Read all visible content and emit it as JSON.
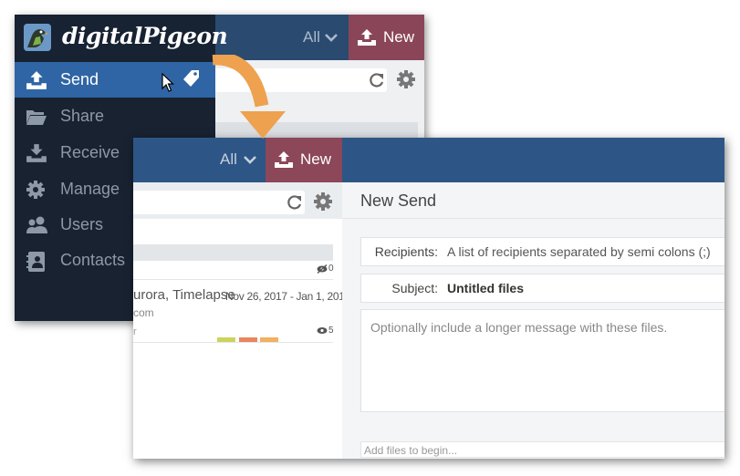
{
  "app": {
    "brand": "digitalPigeon"
  },
  "back_window": {
    "filter": {
      "label": "All",
      "icon": "chevron-down-icon"
    },
    "new_button": {
      "label": "New",
      "icon": "upload-tray-icon"
    },
    "sidebar": {
      "items": [
        {
          "label": "Send",
          "icon": "upload-tray-icon",
          "active": true
        },
        {
          "label": "Share",
          "icon": "folder-open-icon",
          "active": false
        },
        {
          "label": "Receive",
          "icon": "download-tray-icon",
          "active": false
        },
        {
          "label": "Manage",
          "icon": "gear-icon",
          "active": false
        },
        {
          "label": "Users",
          "icon": "users-icon",
          "active": false
        },
        {
          "label": "Contacts",
          "icon": "address-book-icon",
          "active": false
        }
      ]
    }
  },
  "front_window": {
    "filter": {
      "label": "All",
      "icon": "chevron-down-icon"
    },
    "new_button": {
      "label": "New",
      "icon": "upload-tray-icon"
    },
    "list": {
      "hidden_count": "0",
      "items": [
        {
          "name": "urora, Timelapse",
          "dates": "Nov 26, 2017 - Jan 1, 2019",
          "sub": "com",
          "sub2": "r",
          "views": "5",
          "colors": [
            "#cdd35a",
            "#e8875c",
            "#f2b060"
          ]
        }
      ]
    },
    "form": {
      "title": "New Send",
      "recipients_label": "Recipients:",
      "recipients_placeholder": "A list of recipients separated by semi colons (;)",
      "subject_label": "Subject:",
      "subject_value": "Untitled files",
      "message_placeholder": "Optionally include a longer message with these files.",
      "files_placeholder": "Add files to begin..."
    }
  },
  "colors": {
    "topbar_dark": "#172232",
    "topbar_blue": "#2d5686",
    "new_button": "#8c4759",
    "active_nav": "#2f65a4",
    "arrow": "#eea14e"
  }
}
